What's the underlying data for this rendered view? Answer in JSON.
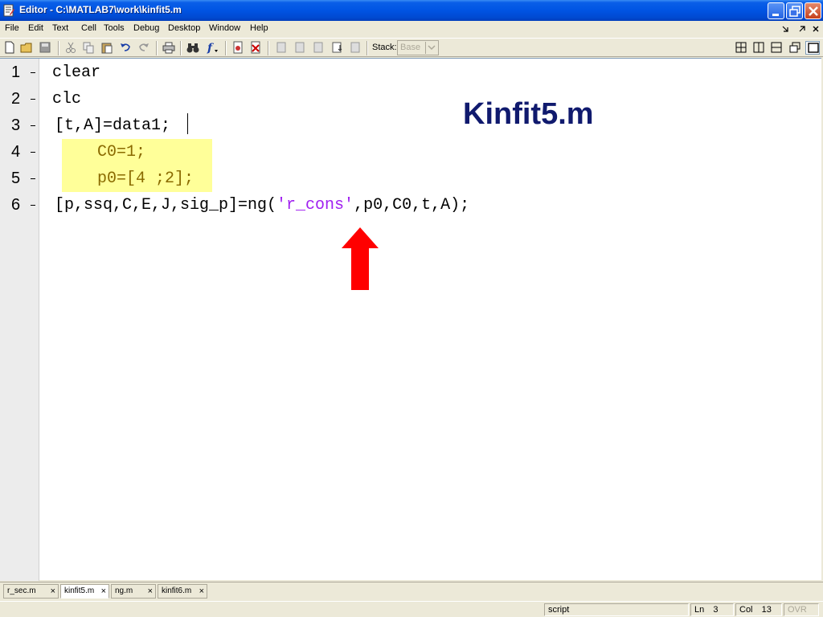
{
  "window": {
    "title": "Editor - C:\\MATLAB7\\work\\kinfit5.m"
  },
  "menu": {
    "items": [
      "File",
      "Edit",
      "Text",
      "Cell",
      "Tools",
      "Debug",
      "Desktop",
      "Window",
      "Help"
    ]
  },
  "toolbar": {
    "stack_label": "Stack:",
    "stack_value": "Base"
  },
  "editor": {
    "line_numbers": [
      "1",
      "2",
      "3",
      "4",
      "5",
      "6"
    ],
    "lines": {
      "l1": "clear",
      "l2": "clc",
      "l3": "[t,A]=data1;",
      "l4": "C0=1;",
      "l5": "p0=[4 ;2];",
      "l6_pre": "[p,ssq,C,E,J,sig_p]=ng(",
      "l6_str": "'r_cons'",
      "l6_post": ",p0,C0,t,A);"
    },
    "overlay_title": "Kinfit5.m",
    "colors": {
      "string": "#a020f0",
      "cell_highlight": "#ffff99",
      "overlay_title": "#101a6e",
      "arrow": "#ff0000"
    }
  },
  "tabs": [
    "r_sec.m",
    "kinfit5.m",
    "ng.m",
    "kinfit6.m"
  ],
  "active_tab": "kinfit5.m",
  "status": {
    "mode": "script",
    "ln_label": "Ln",
    "ln_value": "3",
    "col_label": "Col",
    "col_value": "13",
    "ovr": "OVR"
  }
}
